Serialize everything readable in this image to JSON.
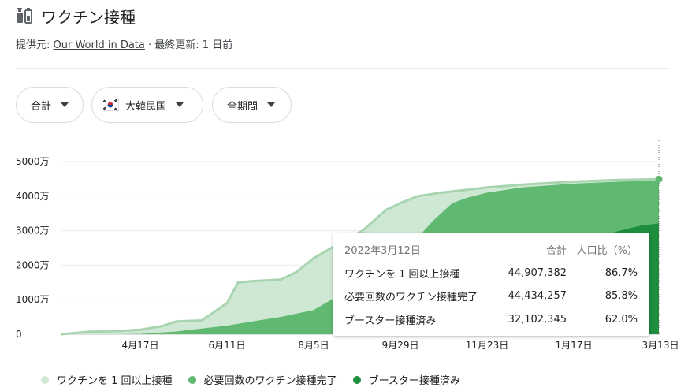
{
  "header": {
    "title": "ワクチン接種",
    "source_prefix": "提供元: ",
    "source_link": "Our World in Data",
    "source_suffix": " · 最終更新: 1 日前"
  },
  "filters": [
    {
      "label": "合計"
    },
    {
      "label": "大韓民国"
    },
    {
      "label": "全期間"
    }
  ],
  "colors": {
    "first_dose": "#cfe8d3",
    "first_dose_line": "#a8d5b0",
    "fully": "#5fb971",
    "booster": "#1e8e3e"
  },
  "tooltip": {
    "date": "2022年3月12日",
    "col_total": "合計",
    "col_pct": "人口比（%）",
    "rows": [
      {
        "label": "ワクチンを 1 回以上接種",
        "total": "44,907,382",
        "pct": "86.7%"
      },
      {
        "label": "必要回数のワクチン接種完了",
        "total": "44,434,257",
        "pct": "85.8%"
      },
      {
        "label": "ブースター接種済み",
        "total": "32,102,345",
        "pct": "62.0%"
      }
    ]
  },
  "legend": [
    {
      "label": "ワクチンを 1 回以上接種",
      "color": "#cfe8d3"
    },
    {
      "label": "必要回数のワクチン接種完了",
      "color": "#5fb971"
    },
    {
      "label": "ブースター接種済み",
      "color": "#1e8e3e"
    }
  ],
  "chart_data": {
    "type": "area",
    "x_range": [
      "2021-02-26",
      "2022-03-13"
    ],
    "x_ticks": [
      {
        "date": "2021-04-17",
        "label": "4月17日"
      },
      {
        "date": "2021-06-11",
        "label": "6月11日"
      },
      {
        "date": "2021-08-05",
        "label": "8月5日"
      },
      {
        "date": "2021-09-29",
        "label": "9月29日"
      },
      {
        "date": "2021-11-23",
        "label": "11月23日"
      },
      {
        "date": "2022-01-17",
        "label": "1月17日"
      },
      {
        "date": "2022-03-13",
        "label": "3月13日"
      }
    ],
    "ylim": [
      0,
      50000000
    ],
    "y_ticks": [
      {
        "value": 0,
        "label": "0"
      },
      {
        "value": 10000000,
        "label": "1000万"
      },
      {
        "value": 20000000,
        "label": "2000万"
      },
      {
        "value": 30000000,
        "label": "3000万"
      },
      {
        "value": 40000000,
        "label": "4000万"
      },
      {
        "value": 50000000,
        "label": "5000万"
      }
    ],
    "grid": true,
    "series": [
      {
        "name": "ワクチンを 1 回以上接種",
        "points": [
          [
            "2021-02-26",
            0
          ],
          [
            "2021-03-15",
            700000
          ],
          [
            "2021-04-01",
            900000
          ],
          [
            "2021-04-17",
            1300000
          ],
          [
            "2021-05-01",
            2400000
          ],
          [
            "2021-05-10",
            3700000
          ],
          [
            "2021-05-26",
            4000000
          ],
          [
            "2021-06-11",
            9000000
          ],
          [
            "2021-06-18",
            15000000
          ],
          [
            "2021-06-28",
            15400000
          ],
          [
            "2021-07-15",
            15800000
          ],
          [
            "2021-07-25",
            18000000
          ],
          [
            "2021-08-05",
            22000000
          ],
          [
            "2021-08-20",
            26000000
          ],
          [
            "2021-09-05",
            30000000
          ],
          [
            "2021-09-20",
            36000000
          ],
          [
            "2021-09-29",
            38000000
          ],
          [
            "2021-10-10",
            40000000
          ],
          [
            "2021-10-25",
            41000000
          ],
          [
            "2021-11-10",
            41800000
          ],
          [
            "2021-11-23",
            42500000
          ],
          [
            "2021-12-15",
            43300000
          ],
          [
            "2022-01-17",
            44200000
          ],
          [
            "2022-02-15",
            44700000
          ],
          [
            "2022-03-12",
            44907382
          ]
        ]
      },
      {
        "name": "必要回数のワクチン接種完了",
        "points": [
          [
            "2021-02-26",
            0
          ],
          [
            "2021-04-01",
            0
          ],
          [
            "2021-04-17",
            100000
          ],
          [
            "2021-05-10",
            800000
          ],
          [
            "2021-06-11",
            2500000
          ],
          [
            "2021-07-01",
            4000000
          ],
          [
            "2021-07-15",
            5000000
          ],
          [
            "2021-08-05",
            7000000
          ],
          [
            "2021-08-20",
            11000000
          ],
          [
            "2021-09-05",
            16000000
          ],
          [
            "2021-09-20",
            20000000
          ],
          [
            "2021-09-29",
            23000000
          ],
          [
            "2021-10-10",
            28000000
          ],
          [
            "2021-10-20",
            33000000
          ],
          [
            "2021-11-01",
            38000000
          ],
          [
            "2021-11-10",
            39500000
          ],
          [
            "2021-11-23",
            41000000
          ],
          [
            "2021-12-15",
            42500000
          ],
          [
            "2022-01-17",
            43600000
          ],
          [
            "2022-02-15",
            44200000
          ],
          [
            "2022-03-12",
            44434257
          ]
        ]
      },
      {
        "name": "ブースター接種済み",
        "points": [
          [
            "2021-02-26",
            0
          ],
          [
            "2021-10-10",
            0
          ],
          [
            "2021-11-01",
            300000
          ],
          [
            "2021-11-23",
            2500000
          ],
          [
            "2021-12-10",
            8000000
          ],
          [
            "2021-12-20",
            15000000
          ],
          [
            "2022-01-01",
            20000000
          ],
          [
            "2022-01-17",
            25000000
          ],
          [
            "2022-02-01",
            28000000
          ],
          [
            "2022-02-15",
            30000000
          ],
          [
            "2022-03-01",
            31500000
          ],
          [
            "2022-03-12",
            32102345
          ]
        ]
      }
    ]
  }
}
